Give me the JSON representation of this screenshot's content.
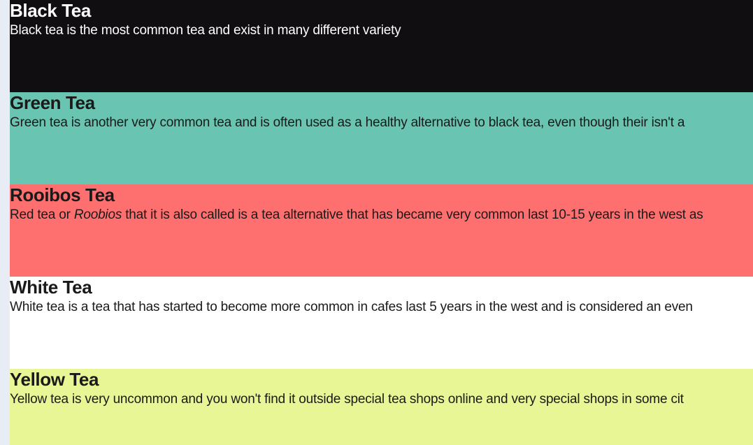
{
  "colors": {
    "page_background": "#e8ecf4",
    "black_bg": "#100e10",
    "green_bg": "#69c4b1",
    "red_bg": "#fe7070",
    "white_bg": "#ffffff",
    "yellow_bg": "#e9f695",
    "light_text": "#ffffff",
    "dark_text": "#1a1a1a"
  },
  "teas": [
    {
      "id": "black",
      "title": "Black Tea",
      "description": "Black tea is the most common tea and exist in many different variety"
    },
    {
      "id": "green",
      "title": "Green Tea",
      "description": "Green tea is another very common tea and is often used as a healthy alternative to black tea, even though their isn't a"
    },
    {
      "id": "rooibos",
      "title": "Rooibos Tea",
      "description_before": "Red tea or ",
      "description_emphasis": "Roobios",
      "description_after": " that it is also called is a tea alternative that has became very common last 10-15 years in the west as"
    },
    {
      "id": "white",
      "title": "White Tea",
      "description": "White tea is a tea that has started to become more common in cafes last 5 years in the west and is considered an even"
    },
    {
      "id": "yellow",
      "title": "Yellow Tea",
      "description": "Yellow tea is very uncommon and you won't find it outside special tea shops online and very special shops in some cit"
    }
  ]
}
